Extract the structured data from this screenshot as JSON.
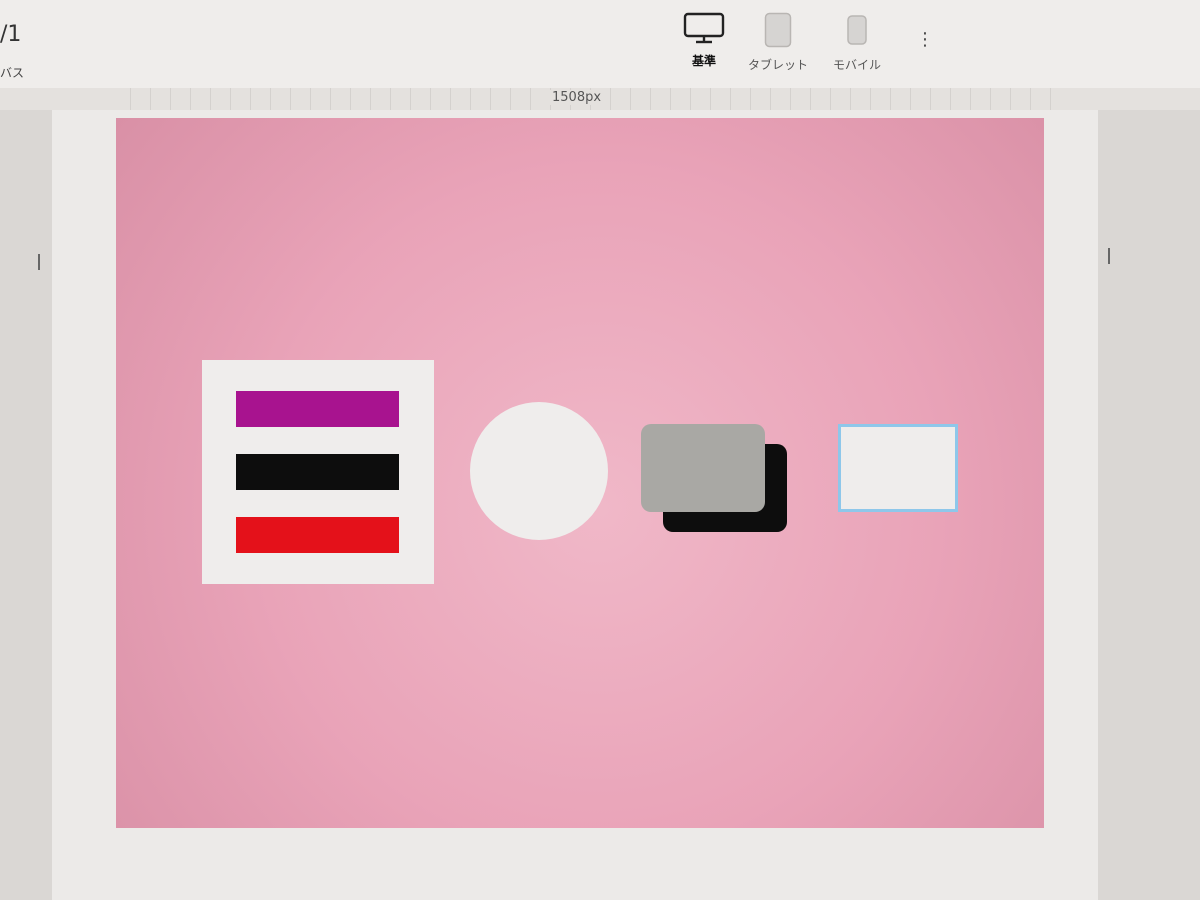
{
  "toolbar": {
    "page_counter": "/1",
    "left_label": "バス",
    "devices": [
      {
        "label": "基準",
        "icon": "monitor-icon",
        "active": true
      },
      {
        "label": "タブレット",
        "icon": "tablet-icon",
        "active": false
      },
      {
        "label": "モバイル",
        "icon": "mobile-icon",
        "active": false
      }
    ],
    "more_icon": "⋮"
  },
  "ruler": {
    "width_label": "1508px"
  },
  "canvas": {
    "background_color": "#e9a3b8",
    "menu_bars": [
      {
        "color": "#a8138f"
      },
      {
        "color": "#0d0d0d"
      },
      {
        "color": "#e4111a"
      }
    ],
    "circle_color": "#efedec",
    "stack_front_color": "#a9a8a4",
    "stack_back_color": "#0d0d0d",
    "outlined_box_border": "#8ec7ea"
  }
}
